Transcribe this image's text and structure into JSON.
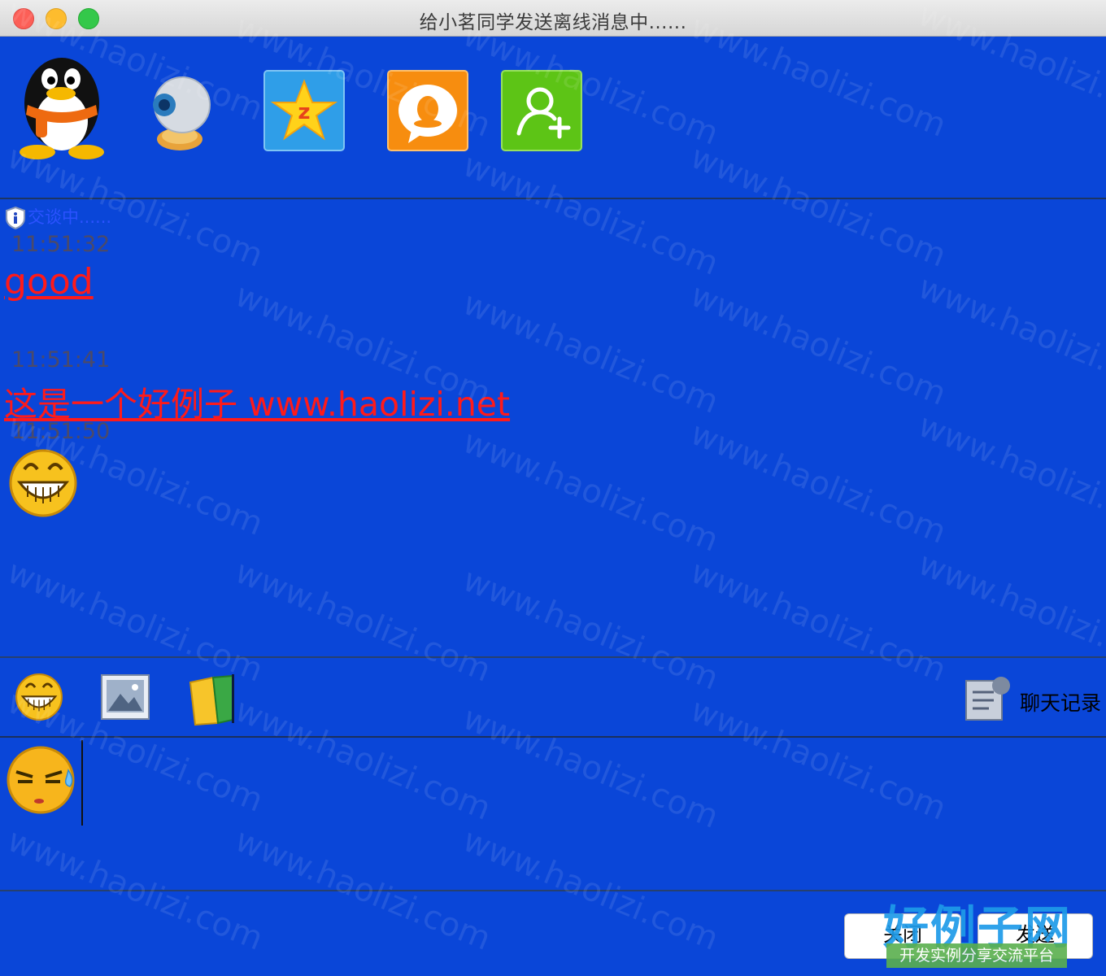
{
  "window": {
    "title": "给小茗同学发送离线消息中......"
  },
  "header": {
    "icons": [
      "qq-penguin-avatar-icon",
      "webcam-icon",
      "qzone-star-icon",
      "qq-chat-bubble-icon",
      "add-friend-icon"
    ]
  },
  "chat": {
    "status": "交谈中......",
    "messages": [
      {
        "time": "11:51:32",
        "text": "good"
      },
      {
        "time": "11:51:41",
        "text": "这是一个好例子 www.haolizi.net"
      },
      {
        "time": "11:51:50",
        "emoji": "grin-emoji"
      }
    ]
  },
  "compose_toolbar": {
    "history_label": "聊天记录"
  },
  "input": {
    "content_emoji": "sweat-emoji"
  },
  "footer": {
    "close_label": "关闭",
    "send_label": "发送"
  },
  "watermark": {
    "repeat_text": "www.haolizi.com",
    "brand": "好例子网",
    "slogan": "开发实例分享交流平台"
  },
  "colors": {
    "background": "#0a46d8",
    "message_text": "#ff1a1a",
    "timestamp": "#4a4a6a"
  }
}
